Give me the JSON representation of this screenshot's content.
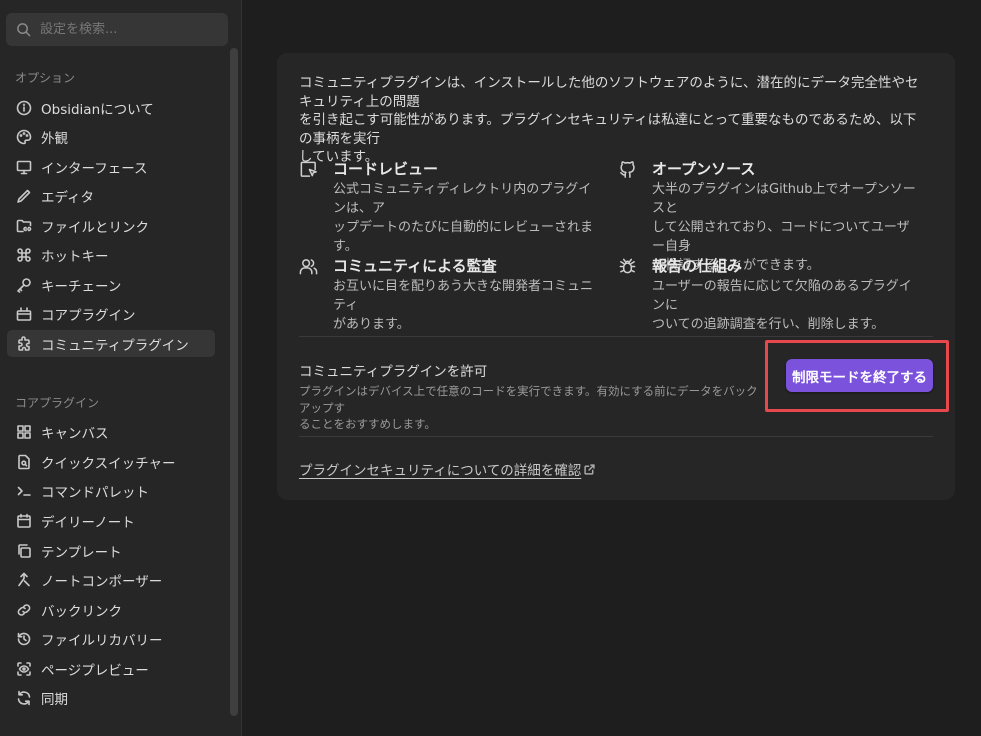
{
  "search": {
    "placeholder": "設定を検索..."
  },
  "sidebar": {
    "options_title": "オプション",
    "options": [
      {
        "label": "Obsidianについて"
      },
      {
        "label": "外観"
      },
      {
        "label": "インターフェース"
      },
      {
        "label": "エディタ"
      },
      {
        "label": "ファイルとリンク"
      },
      {
        "label": "ホットキー"
      },
      {
        "label": "キーチェーン"
      },
      {
        "label": "コアプラグイン"
      },
      {
        "label": "コミュニティプラグイン",
        "active": true
      }
    ],
    "core_title": "コアプラグイン",
    "core": [
      {
        "label": "キャンバス"
      },
      {
        "label": "クイックスイッチャー"
      },
      {
        "label": "コマンドパレット"
      },
      {
        "label": "デイリーノート"
      },
      {
        "label": "テンプレート"
      },
      {
        "label": "ノートコンポーザー"
      },
      {
        "label": "バックリンク"
      },
      {
        "label": "ファイルリカバリー"
      },
      {
        "label": "ページプレビュー"
      },
      {
        "label": "同期"
      }
    ]
  },
  "main": {
    "intro_lines": [
      "コミュニティプラグインは、インストールした他のソフトウェアのように、潜在的にデータ完全性やセキュリティ上の問題",
      "を引き起こす可能性があります。プラグインセキュリティは私達にとって重要なものであるため、以下の事柄を実行",
      "しています。"
    ],
    "features": [
      {
        "title": "コードレビュー",
        "desc_lines": [
          "公式コミュニティディレクトリ内のプラグインは、ア",
          "ップデートのたびに自動的にレビューされます。"
        ]
      },
      {
        "title": "オープンソース",
        "desc_lines": [
          "大半のプラグインはGithub上でオープンソースと",
          "して公開されており、コードについてユーザー自身",
          "で検証することができます。"
        ]
      },
      {
        "title": "コミュニティによる監査",
        "desc_lines": [
          "お互いに目を配りあう大きな開発者コミュニティ",
          "があります。"
        ]
      },
      {
        "title": "報告の仕組み",
        "desc_lines": [
          "ユーザーの報告に応じて欠陥のあるプラグインに",
          "ついての追跡調査を行い、削除します。"
        ]
      }
    ],
    "setting_name": "コミュニティプラグインを許可",
    "setting_desc_lines": [
      "プラグインはデバイス上で任意のコードを実行できます。有効にする前にデータをバックアップす",
      "ることをおすすめします。"
    ],
    "button_label": "制限モードを終了する",
    "link_label": "プラグインセキュリティについての詳細を確認"
  },
  "colors": {
    "accent": "#7b52db",
    "highlight": "#e5484d"
  }
}
